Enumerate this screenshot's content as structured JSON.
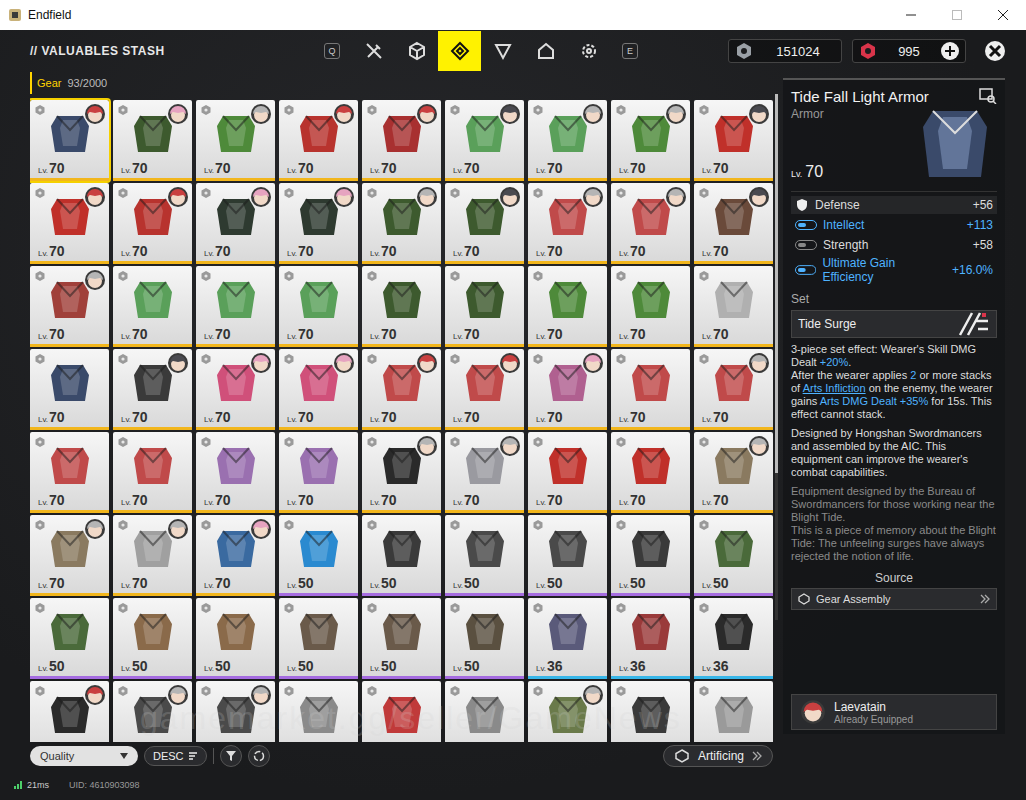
{
  "window": {
    "title": "Endfield"
  },
  "header": {
    "title": "// VALUABLES STASH",
    "prev_key": "Q",
    "next_key": "E",
    "tabs": [
      {
        "selected": false
      },
      {
        "selected": false
      },
      {
        "selected": true
      },
      {
        "selected": false
      },
      {
        "selected": false
      },
      {
        "selected": false
      }
    ]
  },
  "currencies": [
    {
      "amount": "151024",
      "color": "#9aa0a6",
      "add": false
    },
    {
      "amount": "995",
      "color": "#d9344a",
      "add": true
    }
  ],
  "category": {
    "label": "Gear",
    "count": "93/2000"
  },
  "level_prefix": "Lv.",
  "items": [
    {
      "level": "70",
      "rarity": "gold",
      "color": "#3a4a6a",
      "equipped": true,
      "avatar": "#c94040",
      "selected": true
    },
    {
      "level": "70",
      "rarity": "gold",
      "color": "#3d5a2e",
      "equipped": true,
      "avatar": "#e6a3c0",
      "selected": false
    },
    {
      "level": "70",
      "rarity": "gold",
      "color": "#4e8a3a",
      "equipped": true,
      "avatar": "#b5b5b5",
      "selected": false
    },
    {
      "level": "70",
      "rarity": "gold",
      "color": "#b8332e",
      "equipped": true,
      "avatar": "#c94040",
      "selected": false
    },
    {
      "level": "70",
      "rarity": "gold",
      "color": "#a83030",
      "equipped": true,
      "avatar": "#c94040",
      "selected": false
    },
    {
      "level": "70",
      "rarity": "gold",
      "color": "#5aa05a",
      "equipped": true,
      "avatar": "#4a4a50",
      "selected": false
    },
    {
      "level": "70",
      "rarity": "gold",
      "color": "#5aa05a",
      "equipped": true,
      "avatar": "#b5b5b5",
      "selected": false
    },
    {
      "level": "70",
      "rarity": "gold",
      "color": "#4e8a3a",
      "equipped": true,
      "avatar": "#b5b5b5",
      "selected": false
    },
    {
      "level": "70",
      "rarity": "gold",
      "color": "#c0302a",
      "equipped": true,
      "avatar": "#4a4a50",
      "selected": false
    },
    {
      "level": "70",
      "rarity": "gold",
      "color": "#c0302a",
      "equipped": true,
      "avatar": "#c94040",
      "selected": false
    },
    {
      "level": "70",
      "rarity": "gold",
      "color": "#b8332e",
      "equipped": true,
      "avatar": "#c94040",
      "selected": false
    },
    {
      "level": "70",
      "rarity": "gold",
      "color": "#2e3a30",
      "equipped": true,
      "avatar": "#e6a3c0",
      "selected": false
    },
    {
      "level": "70",
      "rarity": "gold",
      "color": "#2e3a30",
      "equipped": true,
      "avatar": "#e6a3c0",
      "selected": false
    },
    {
      "level": "70",
      "rarity": "gold",
      "color": "#3d5a2e",
      "equipped": true,
      "avatar": "#b5b5b5",
      "selected": false
    },
    {
      "level": "70",
      "rarity": "gold",
      "color": "#3d5a2e",
      "equipped": true,
      "avatar": "#4a4a50",
      "selected": false
    },
    {
      "level": "70",
      "rarity": "gold",
      "color": "#c04a4a",
      "equipped": true,
      "avatar": "#b5b5b5",
      "selected": false
    },
    {
      "level": "70",
      "rarity": "gold",
      "color": "#c04a4a",
      "equipped": true,
      "avatar": "#b5b5b5",
      "selected": false
    },
    {
      "level": "70",
      "rarity": "gold",
      "color": "#6a4a3a",
      "equipped": true,
      "avatar": "#4a4a50",
      "selected": false
    },
    {
      "level": "70",
      "rarity": "gold",
      "color": "#a0403a",
      "equipped": true,
      "avatar": "#b5b5b5",
      "selected": false
    },
    {
      "level": "70",
      "rarity": "gold",
      "color": "#5aa05a",
      "equipped": false,
      "avatar": null,
      "selected": false
    },
    {
      "level": "70",
      "rarity": "gold",
      "color": "#5aa05a",
      "equipped": false,
      "avatar": null,
      "selected": false
    },
    {
      "level": "70",
      "rarity": "gold",
      "color": "#5aa05a",
      "equipped": false,
      "avatar": null,
      "selected": false
    },
    {
      "level": "70",
      "rarity": "gold",
      "color": "#3d5a2e",
      "equipped": false,
      "avatar": null,
      "selected": false
    },
    {
      "level": "70",
      "rarity": "gold",
      "color": "#3d5a2e",
      "equipped": false,
      "avatar": null,
      "selected": false
    },
    {
      "level": "70",
      "rarity": "gold",
      "color": "#4e8a3a",
      "equipped": false,
      "avatar": null,
      "selected": false
    },
    {
      "level": "70",
      "rarity": "gold",
      "color": "#4e8a3a",
      "equipped": false,
      "avatar": null,
      "selected": false
    },
    {
      "level": "70",
      "rarity": "gold",
      "color": "#b0b0b0",
      "equipped": false,
      "avatar": null,
      "selected": false
    },
    {
      "level": "70",
      "rarity": "gold",
      "color": "#3a4a6a",
      "equipped": false,
      "avatar": null,
      "selected": false
    },
    {
      "level": "70",
      "rarity": "gold",
      "color": "#3a3a3a",
      "equipped": true,
      "avatar": "#4a4a50",
      "selected": false
    },
    {
      "level": "70",
      "rarity": "gold",
      "color": "#d0507a",
      "equipped": true,
      "avatar": "#e6a3c0",
      "selected": false
    },
    {
      "level": "70",
      "rarity": "gold",
      "color": "#d0507a",
      "equipped": true,
      "avatar": "#e6a3c0",
      "selected": false
    },
    {
      "level": "70",
      "rarity": "gold",
      "color": "#c04a4a",
      "equipped": true,
      "avatar": "#c94040",
      "selected": false
    },
    {
      "level": "70",
      "rarity": "gold",
      "color": "#c04a4a",
      "equipped": true,
      "avatar": "#c94040",
      "selected": false
    },
    {
      "level": "70",
      "rarity": "gold",
      "color": "#b06090",
      "equipped": true,
      "avatar": "#e6a3c0",
      "selected": false
    },
    {
      "level": "70",
      "rarity": "gold",
      "color": "#c04a4a",
      "equipped": false,
      "avatar": null,
      "selected": false
    },
    {
      "level": "70",
      "rarity": "gold",
      "color": "#c04a4a",
      "equipped": true,
      "avatar": "#b5b5b5",
      "selected": false
    },
    {
      "level": "70",
      "rarity": "gold",
      "color": "#c04a4a",
      "equipped": false,
      "avatar": null,
      "selected": false
    },
    {
      "level": "70",
      "rarity": "gold",
      "color": "#c04a4a",
      "equipped": false,
      "avatar": null,
      "selected": false
    },
    {
      "level": "70",
      "rarity": "gold",
      "color": "#9a70b0",
      "equipped": false,
      "avatar": null,
      "selected": false
    },
    {
      "level": "70",
      "rarity": "gold",
      "color": "#9a70b0",
      "equipped": false,
      "avatar": null,
      "selected": false
    },
    {
      "level": "70",
      "rarity": "gold",
      "color": "#2a2a2a",
      "equipped": true,
      "avatar": "#b5b5b5",
      "selected": false
    },
    {
      "level": "70",
      "rarity": "gold",
      "color": "#9a9aa0",
      "equipped": true,
      "avatar": "#b5b5b5",
      "selected": false
    },
    {
      "level": "70",
      "rarity": "gold",
      "color": "#c0302a",
      "equipped": false,
      "avatar": null,
      "selected": false
    },
    {
      "level": "70",
      "rarity": "gold",
      "color": "#c0302a",
      "equipped": false,
      "avatar": null,
      "selected": false
    },
    {
      "level": "70",
      "rarity": "gold",
      "color": "#8a7a60",
      "equipped": true,
      "avatar": "#b5b5b5",
      "selected": false
    },
    {
      "level": "70",
      "rarity": "gold",
      "color": "#8a7a60",
      "equipped": true,
      "avatar": "#b5b5b5",
      "selected": false
    },
    {
      "level": "70",
      "rarity": "gold",
      "color": "#a0a0a0",
      "equipped": true,
      "avatar": "#b5b5b5",
      "selected": false
    },
    {
      "level": "70",
      "rarity": "gold",
      "color": "#3a6aa0",
      "equipped": true,
      "avatar": "#e6a3c0",
      "selected": false
    },
    {
      "level": "50",
      "rarity": "purple",
      "color": "#2a8ad0",
      "equipped": false,
      "avatar": null,
      "selected": false
    },
    {
      "level": "50",
      "rarity": "purple",
      "color": "#3a3a3a",
      "equipped": false,
      "avatar": null,
      "selected": false
    },
    {
      "level": "50",
      "rarity": "purple",
      "color": "#4a4a4a",
      "equipped": false,
      "avatar": null,
      "selected": false
    },
    {
      "level": "50",
      "rarity": "purple",
      "color": "#4a4a4a",
      "equipped": false,
      "avatar": null,
      "selected": false
    },
    {
      "level": "50",
      "rarity": "purple",
      "color": "#3a3a3a",
      "equipped": false,
      "avatar": null,
      "selected": false
    },
    {
      "level": "50",
      "rarity": "purple",
      "color": "#4a6a3a",
      "equipped": false,
      "avatar": null,
      "selected": false
    },
    {
      "level": "50",
      "rarity": "purple",
      "color": "#4a6a3a",
      "equipped": false,
      "avatar": null,
      "selected": false
    },
    {
      "level": "50",
      "rarity": "purple",
      "color": "#8a6a4a",
      "equipped": false,
      "avatar": null,
      "selected": false
    },
    {
      "level": "50",
      "rarity": "purple",
      "color": "#8a6a4a",
      "equipped": false,
      "avatar": null,
      "selected": false
    },
    {
      "level": "50",
      "rarity": "purple",
      "color": "#6a5a4a",
      "equipped": false,
      "avatar": null,
      "selected": false
    },
    {
      "level": "50",
      "rarity": "purple",
      "color": "#6a5a4a",
      "equipped": false,
      "avatar": null,
      "selected": false
    },
    {
      "level": "50",
      "rarity": "purple",
      "color": "#5a5040",
      "equipped": false,
      "avatar": null,
      "selected": false
    },
    {
      "level": "36",
      "rarity": "blue",
      "color": "#5a5a7a",
      "equipped": false,
      "avatar": null,
      "selected": false
    },
    {
      "level": "36",
      "rarity": "blue",
      "color": "#9a3a3a",
      "equipped": false,
      "avatar": null,
      "selected": false
    },
    {
      "level": "36",
      "rarity": "blue",
      "color": "#2a2a2a",
      "equipped": false,
      "avatar": null,
      "selected": false
    },
    {
      "level": "",
      "rarity": "none",
      "color": "#2a2a2a",
      "equipped": true,
      "avatar": "#c94040",
      "selected": false
    },
    {
      "level": "",
      "rarity": "none",
      "color": "#4a4a4a",
      "equipped": true,
      "avatar": "#b5b5b5",
      "selected": false
    },
    {
      "level": "",
      "rarity": "none",
      "color": "#4a4a4a",
      "equipped": true,
      "avatar": "#b5b5b5",
      "selected": false
    },
    {
      "level": "",
      "rarity": "none",
      "color": "#8a8a8a",
      "equipped": false,
      "avatar": null,
      "selected": false
    },
    {
      "level": "",
      "rarity": "none",
      "color": "#c03a3a",
      "equipped": false,
      "avatar": null,
      "selected": false
    },
    {
      "level": "",
      "rarity": "none",
      "color": "#8a8a8a",
      "equipped": false,
      "avatar": null,
      "selected": false
    },
    {
      "level": "",
      "rarity": "none",
      "color": "#6a7a4a",
      "equipped": true,
      "avatar": "#b5b5b5",
      "selected": false
    },
    {
      "level": "",
      "rarity": "none",
      "color": "#3a3a3a",
      "equipped": false,
      "avatar": null,
      "selected": false
    },
    {
      "level": "",
      "rarity": "none",
      "color": "#9a9a9a",
      "equipped": false,
      "avatar": null,
      "selected": false
    }
  ],
  "toolbar": {
    "sort": "Quality",
    "order": "DESC",
    "artificing": "Artificing"
  },
  "detail": {
    "name": "Tide Fall Light Armor",
    "type": "Armor",
    "level": "70",
    "stats": [
      {
        "label": "Defense",
        "value": "+56",
        "kind": "base"
      },
      {
        "label": "Intellect",
        "value": "+113",
        "kind": "boosted"
      },
      {
        "label": "Strength",
        "value": "+58",
        "kind": "attribute"
      },
      {
        "label": "Ultimate Gain Efficiency",
        "value": "+16.0%",
        "kind": "boosted"
      }
    ],
    "set_label": "Set",
    "set_name": "Tide Surge",
    "effect": [
      {
        "text": "3-piece set effect: Wearer's Skill DMG Dealt ",
        "style": "plain"
      },
      {
        "text": "+20%",
        "style": "value"
      },
      {
        "text": ".\nAfter the wearer applies ",
        "style": "plain"
      },
      {
        "text": "2",
        "style": "value"
      },
      {
        "text": " or more stacks of ",
        "style": "plain"
      },
      {
        "text": "Arts Infliction",
        "style": "link"
      },
      {
        "text": " on the enemy, the wearer gains ",
        "style": "plain"
      },
      {
        "text": "Arts DMG Dealt +35%",
        "style": "value"
      },
      {
        "text": " for 15s. This effect cannot stack.",
        "style": "plain"
      }
    ],
    "description": "Designed by Hongshan Swordmancers and assembled by the AIC. This equipment can improve the wearer's combat capabilities.",
    "lore": "Equipment designed by the Bureau of Swordmancers for those working near the Blight Tide.\nThis is a piece of memory about the Blight Tide: The unfeeling surges have always rejected the notion of life.",
    "source_label": "Source",
    "source": "Gear Assembly",
    "equipped_by": {
      "name": "Laevatain",
      "status": "Already Equipped",
      "avatar": "#c94040"
    }
  },
  "watermark": "gamemarket.gg/seller/GameNews",
  "status": {
    "ping": "21ms",
    "uid": "UID: 4610903098"
  }
}
